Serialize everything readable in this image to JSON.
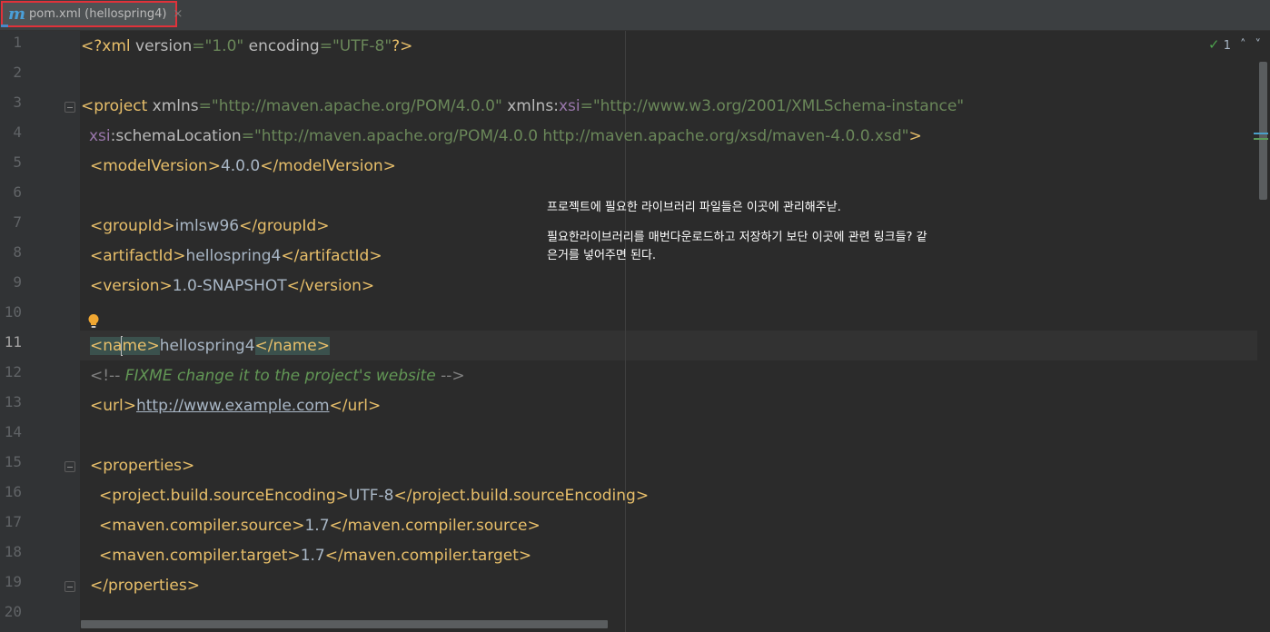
{
  "tab": {
    "icon_letter": "m",
    "label": "pom.xml (hellospring4)",
    "close": "×"
  },
  "status": {
    "check": "✓",
    "count": "1",
    "up": "˄",
    "down": "˅"
  },
  "lines": [
    "1",
    "2",
    "3",
    "4",
    "5",
    "6",
    "7",
    "8",
    "9",
    "10",
    "11",
    "12",
    "13",
    "14",
    "15",
    "16",
    "17",
    "18",
    "19",
    "20"
  ],
  "active_line": "11",
  "code": {
    "l1": {
      "open": "<?",
      "tag": "xml",
      "a1": " version",
      "eq1": "=",
      "v1": "\"1.0\"",
      "a2": " encoding",
      "eq2": "=",
      "v2": "\"UTF-8\"",
      "close": "?>"
    },
    "l3": {
      "open": "<",
      "tag": "project",
      "a1": " xmlns",
      "eq1": "=",
      "v1": "\"http://maven.apache.org/POM/4.0.0\"",
      "a2": " xmlns",
      "colon": ":",
      "ns": "xsi",
      "eq2": "=",
      "v2": "\"http://www.w3.org/2001/XMLSchema-instance\""
    },
    "l4": {
      "ns": "xsi",
      "colon": ":",
      "attr": "schemaLocation",
      "eq": "=",
      "val": "\"http://maven.apache.org/POM/4.0.0 http://maven.apache.org/xsd/maven-4.0.0.xsd\"",
      "close": ">"
    },
    "l5": {
      "open": "<modelVersion>",
      "text": "4.0.0",
      "close": "</modelVersion>"
    },
    "l7": {
      "open": "<groupId>",
      "text": "imlsw96",
      "close": "</groupId>"
    },
    "l8": {
      "open": "<artifactId>",
      "text": "hellospring4",
      "close": "</artifactId>"
    },
    "l9": {
      "open": "<version>",
      "text": "1.0-SNAPSHOT",
      "close": "</version>"
    },
    "l11": {
      "open_a": "<na",
      "open_b": "me>",
      "text": "hellospring4",
      "close": "</name>"
    },
    "l12": {
      "start": "<!-- ",
      "text": "FIXME change it to the project's website",
      "end": " -->"
    },
    "l13": {
      "open": "<url>",
      "text": "http://www.example.com",
      "close": "</url>"
    },
    "l15": {
      "text": "<properties>"
    },
    "l16": {
      "open": "<project.build.sourceEncoding>",
      "text": "UTF-8",
      "close": "</project.build.sourceEncoding>"
    },
    "l17": {
      "open": "<maven.compiler.source>",
      "text": "1.7",
      "close": "</maven.compiler.source>"
    },
    "l18": {
      "open": "<maven.compiler.target>",
      "text": "1.7",
      "close": "</maven.compiler.target>"
    },
    "l19": {
      "text": "</properties>"
    }
  },
  "note": {
    "line1": "프로젝트에 필요한 라이브러리 파일들은 이곳에 관리해주낟.",
    "line2": "필요한라이브러리를 매번다운로드하고 저장하기 보단 이곳에 관련 링크들? 같은거를 넣어주면 된다."
  },
  "colors": {
    "tag": "#e8bf6a",
    "value": "#6a8759",
    "namespace": "#9876aa",
    "comment": "#629755",
    "tab_border": "#e0323a"
  }
}
